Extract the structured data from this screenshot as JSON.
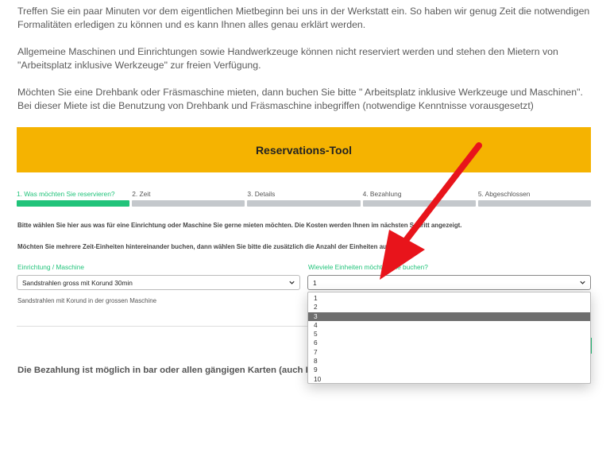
{
  "intro": {
    "p1": "Treffen Sie ein paar Minuten vor dem eigentlichen Mietbeginn bei uns in der Werkstatt ein. So haben wir genug Zeit die notwendigen Formalitäten erledigen zu können und es kann Ihnen alles genau erklärt werden.",
    "p2": "Allgemeine Maschinen und Einrichtungen sowie Handwerkzeuge können nicht reserviert werden und stehen den Mietern von \"Arbeitsplatz inklusive Werkzeuge\" zur freien Verfügung.",
    "p3": "Möchten Sie eine Drehbank oder Fräsmaschine mieten, dann buchen Sie bitte \" Arbeitsplatz inklusive Werkzeuge und Maschinen\". Bei dieser Miete ist die Benutzung von Drehbank und Fräsmaschine inbegriffen (notwendige Kenntnisse vorausgesetzt)"
  },
  "banner": {
    "title": "Reservations-Tool",
    "color": "#f5b301"
  },
  "steps": [
    {
      "label": "1. Was möchten Sie reservieren?",
      "active": true
    },
    {
      "label": "2. Zeit",
      "active": false
    },
    {
      "label": "3. Details",
      "active": false
    },
    {
      "label": "4. Bezahlung",
      "active": false
    },
    {
      "label": "5. Abgeschlossen",
      "active": false
    }
  ],
  "info": {
    "line1": "Bitte wählen Sie hier aus was für eine Einrichtung oder Maschine Sie gerne mieten möchten. Die Kosten werden Ihnen im nächsten Schritt angezeigt.",
    "line2": "Möchten Sie mehrere Zeit-Einheiten hintereinander buchen, dann wählen Sie bitte die zusätzlich die Anzahl der Einheiten aus."
  },
  "form": {
    "equipment_label": "Einrichtung / Maschine",
    "equipment_value": "Sandstrahlen gross mit Korund 30min",
    "equipment_description": "Sandstrahlen mit Korund in der grossen Maschine",
    "units_label": "Wieviele Einheiten möchten Sie buchen?",
    "units_value": "1",
    "units_options": [
      "1",
      "2",
      "3",
      "4",
      "5",
      "6",
      "7",
      "8",
      "9",
      "10"
    ],
    "units_highlighted": "3"
  },
  "payment_text": "Die Bezahlung ist möglich in bar oder allen gängigen Karten (auch Kontaktlos)",
  "colors": {
    "accent_green": "#21c37a",
    "annotation_arrow": "#e8141b"
  },
  "annotation": {
    "icon": "red-arrow-icon"
  }
}
